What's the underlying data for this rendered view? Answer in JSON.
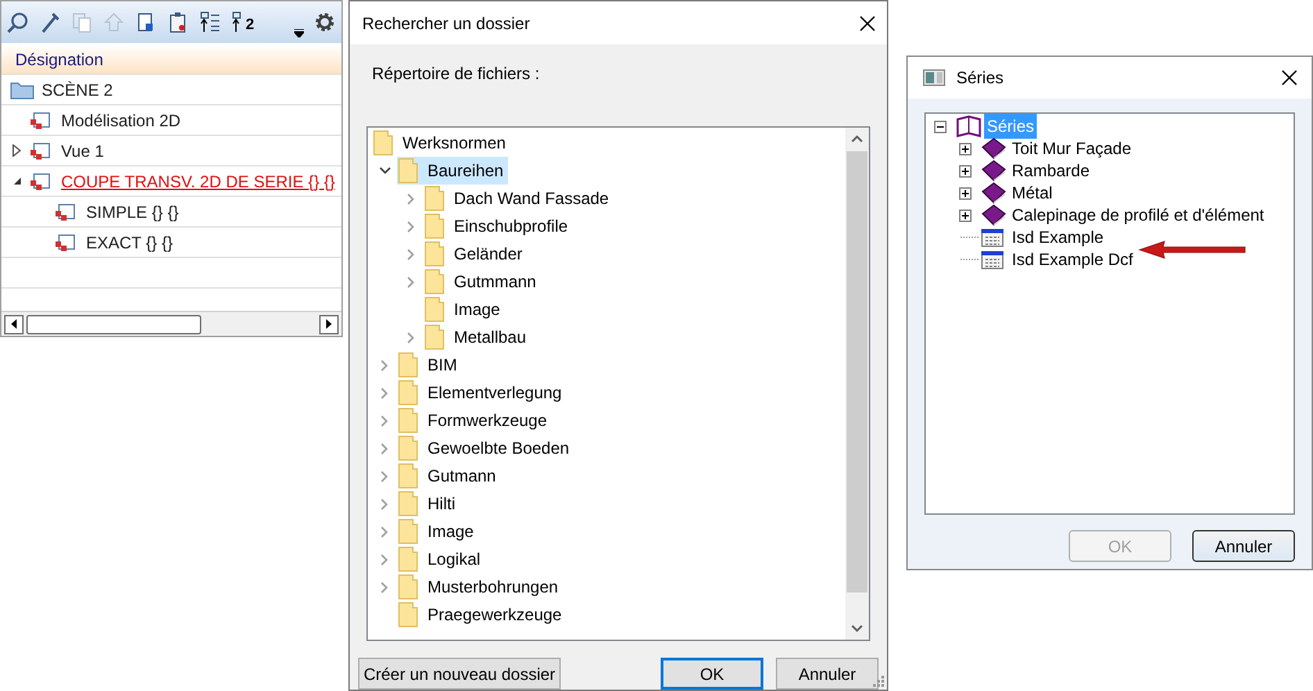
{
  "scene_panel": {
    "toolbar": [
      {
        "kind": "search",
        "disabled": false
      },
      {
        "kind": "tool",
        "disabled": false
      },
      {
        "kind": "copy",
        "disabled": true
      },
      {
        "kind": "up",
        "disabled": true
      },
      {
        "kind": "doc",
        "disabled": false
      },
      {
        "kind": "paste",
        "disabled": false
      },
      {
        "kind": "list",
        "disabled": false
      },
      {
        "kind": "num",
        "disabled": false
      }
    ],
    "number_label": "2",
    "header": "Désignation",
    "tree": [
      {
        "label": "SCÈNE 2",
        "kind": "folder",
        "highlighted": false,
        "children": [
          {
            "label": "Modélisation 2D",
            "kind": "view",
            "highlighted": false
          },
          {
            "label": "Vue 1",
            "kind": "view",
            "expanded": false,
            "highlighted": false
          },
          {
            "label": "COUPE TRANSV. 2D DE SERIE {} {}",
            "kind": "view",
            "expanded": true,
            "highlighted": true,
            "children": [
              {
                "label": "SIMPLE {} {}",
                "kind": "view",
                "highlighted": false
              },
              {
                "label": "EXACT {} {}",
                "kind": "view",
                "highlighted": false
              }
            ]
          }
        ]
      }
    ]
  },
  "folder_dialog": {
    "title": "Rechercher un dossier",
    "prompt": "Répertoire de fichiers :",
    "tree": [
      {
        "label": "Werksnormen",
        "selected": false,
        "children": [
          {
            "label": "Baureihen",
            "expanded": true,
            "selected": true,
            "children": [
              {
                "label": "Dach Wand Fassade",
                "expanded": false,
                "selected": false
              },
              {
                "label": "Einschubprofile",
                "expanded": false,
                "selected": false
              },
              {
                "label": "Geländer",
                "expanded": false,
                "selected": false
              },
              {
                "label": "Gutmmann",
                "expanded": false,
                "selected": false
              },
              {
                "label": "Image",
                "selected": false
              },
              {
                "label": "Metallbau",
                "expanded": false,
                "selected": false
              }
            ]
          },
          {
            "label": "BIM",
            "expanded": false,
            "selected": false
          },
          {
            "label": "Elementverlegung",
            "expanded": false,
            "selected": false
          },
          {
            "label": "Formwerkzeuge",
            "expanded": false,
            "selected": false
          },
          {
            "label": "Gewoelbte Boeden",
            "expanded": false,
            "selected": false
          },
          {
            "label": "Gutmann",
            "expanded": false,
            "selected": false
          },
          {
            "label": "Hilti",
            "expanded": false,
            "selected": false
          },
          {
            "label": "Image",
            "expanded": false,
            "selected": false
          },
          {
            "label": "Logikal",
            "expanded": false,
            "selected": false
          },
          {
            "label": "Musterbohrungen",
            "expanded": false,
            "selected": false
          },
          {
            "label": "Praegewerkzeuge",
            "selected": false
          }
        ]
      }
    ],
    "buttons": [
      {
        "label": "Créer un nouveau dossier",
        "kind": "new",
        "default": false
      },
      {
        "label": "OK",
        "kind": "ok",
        "default": true
      },
      {
        "label": "Annuler",
        "kind": "cancel",
        "default": false
      }
    ]
  },
  "series_dialog": {
    "title": "Séries",
    "tree": [
      {
        "label": "Séries",
        "kind": "open-book",
        "expanded": true,
        "selected": true,
        "children": [
          {
            "label": "Toit Mur Façade",
            "kind": "book",
            "expanded": false,
            "selected": false
          },
          {
            "label": "Rambarde",
            "kind": "book",
            "expanded": false,
            "selected": false
          },
          {
            "label": "Métal",
            "kind": "book",
            "expanded": false,
            "selected": false
          },
          {
            "label": "Calepinage de profilé et d'élément",
            "kind": "book",
            "expanded": false,
            "selected": false
          },
          {
            "label": "Isd Example",
            "kind": "table",
            "selected": false
          },
          {
            "label": "Isd Example Dcf",
            "kind": "table",
            "selected": false
          }
        ]
      }
    ],
    "buttons": [
      {
        "label": "OK",
        "disabled": true
      },
      {
        "label": "Annuler",
        "disabled": false
      }
    ]
  }
}
